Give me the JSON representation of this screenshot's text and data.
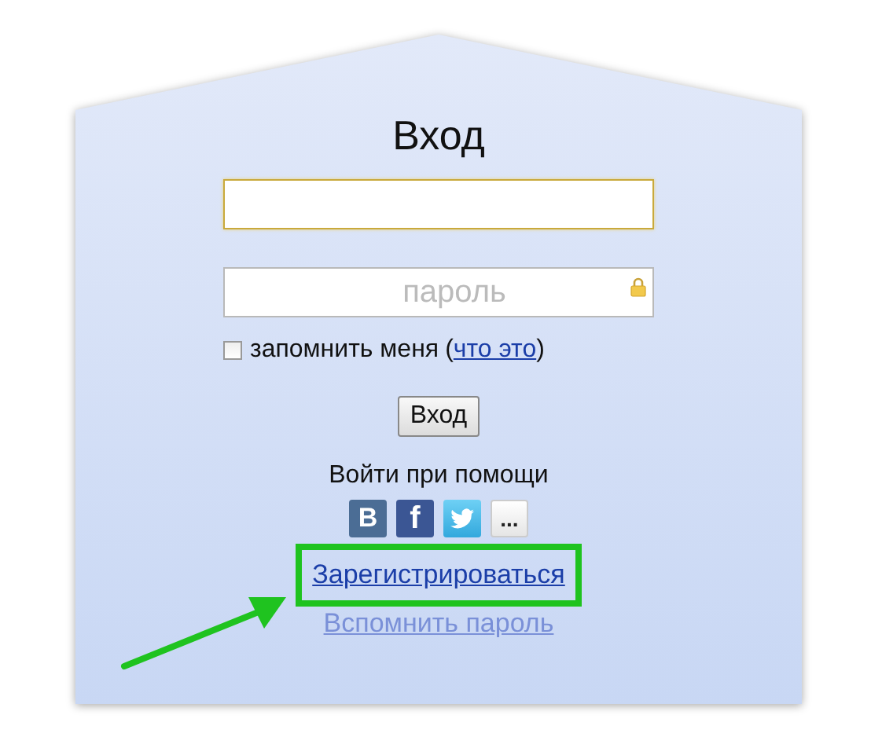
{
  "title": "Вход",
  "login_field": {
    "focused": true
  },
  "password_field": {
    "placeholder": "пароль"
  },
  "remember": {
    "checked": false,
    "label": "запомнить меня",
    "open_paren": "(",
    "link": "что это",
    "close_paren": ")"
  },
  "submit_button": "Вход",
  "social": {
    "caption": "Войти при помощи",
    "items": [
      {
        "kind": "vk",
        "label": "B"
      },
      {
        "kind": "facebook",
        "label": "f"
      },
      {
        "kind": "twitter"
      },
      {
        "kind": "more",
        "label": "..."
      }
    ]
  },
  "register_link": {
    "text": "Зарегистрироваться",
    "highlighted": true
  },
  "forgot_link": "Вспомнить пароль"
}
